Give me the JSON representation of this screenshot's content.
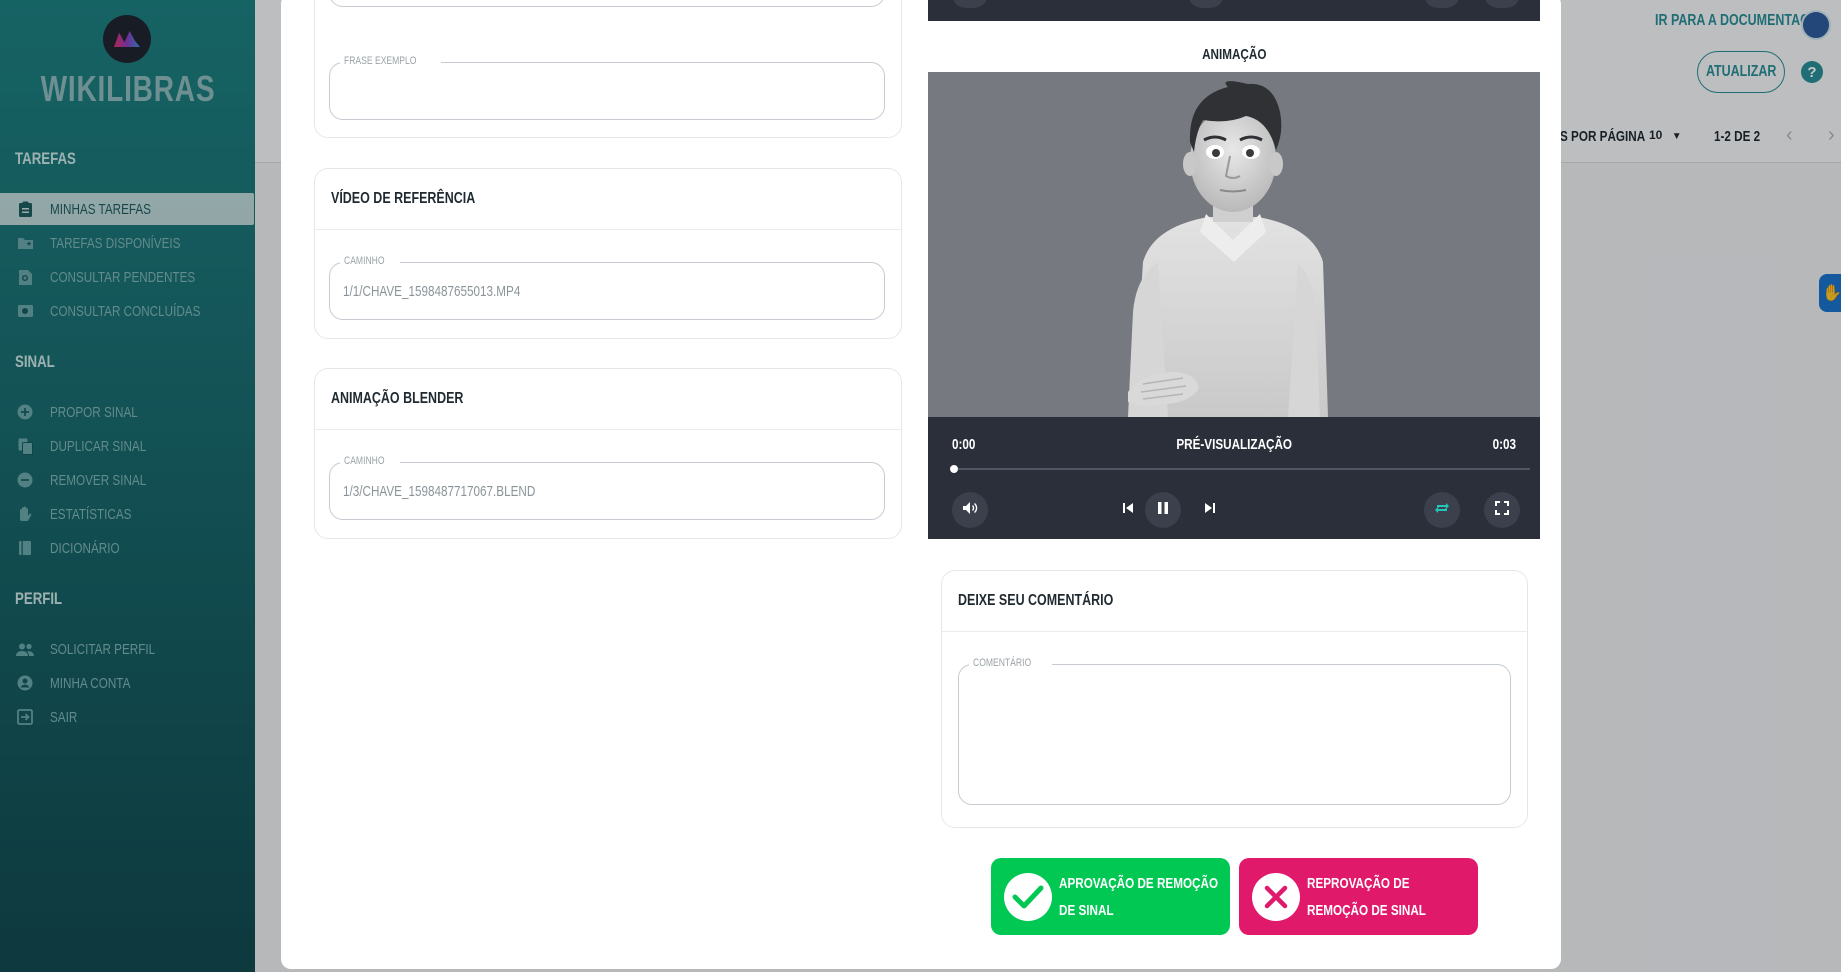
{
  "app": {
    "name": "WIKILIBRAS"
  },
  "sidebar": {
    "sections": [
      {
        "title": "TAREFAS"
      },
      {
        "title": "SINAL"
      },
      {
        "title": "PERFIL"
      }
    ],
    "items": [
      {
        "label": "MINHAS TAREFAS",
        "icon": "clipboard-icon",
        "active": true
      },
      {
        "label": "TAREFAS DISPONÍVEIS",
        "icon": "folder-add-icon"
      },
      {
        "label": "CONSULTAR PENDENTES",
        "icon": "search-doc-icon"
      },
      {
        "label": "CONSULTAR CONCLUÍDAS",
        "icon": "image-search-icon"
      },
      {
        "label": "PROPOR SINAL",
        "icon": "plus-circle-icon"
      },
      {
        "label": "DUPLICAR SINAL",
        "icon": "copy-icon"
      },
      {
        "label": "REMOVER SINAL",
        "icon": "minus-circle-icon"
      },
      {
        "label": "ESTATÍSTICAS",
        "icon": "hand-icon"
      },
      {
        "label": "DICIONÁRIO",
        "icon": "book-icon"
      },
      {
        "label": "SOLICITAR PERFIL",
        "icon": "people-icon"
      },
      {
        "label": "MINHA CONTA",
        "icon": "account-circle-icon"
      },
      {
        "label": "SAIR",
        "icon": "exit-icon"
      }
    ]
  },
  "header": {
    "doc_link": "IR PARA A DOCUMENTAÇÃO",
    "refresh_label": "ATUALIZAR",
    "help_label": "?",
    "per_page_label": "S POR PÁGINA",
    "per_page_value": "10",
    "page_range": "1-2 DE 2"
  },
  "form": {
    "example_phrase": {
      "legend": "FRASE EXEMPLO",
      "value": ""
    },
    "reference_video": {
      "title": "VÍDEO DE REFERÊNCIA",
      "legend": "CAMINHO",
      "value": "1/1/CHAVE_1598487655013.MP4"
    },
    "blender_animation": {
      "title": "ANIMAÇÃO BLENDER",
      "legend": "CAMINHO",
      "value": "1/3/CHAVE_1598487717067.BLEND"
    }
  },
  "player": {
    "section_title": "ANIMAÇÃO",
    "time_current": "0:00",
    "title": "PRÉ-VISUALIZAÇÃO",
    "time_total": "0:03",
    "progress": 0.0
  },
  "comment": {
    "title": "DEIXE SEU COMENTÁRIO",
    "legend": "COMENTÁRIO",
    "value": ""
  },
  "actions": {
    "approve_label": "APROVAÇÃO DE REMOÇÃO DE SINAL",
    "reject_label": "REPROVAÇÃO DE REMOÇÃO DE SINAL"
  },
  "colors": {
    "brand": "#1d7f80",
    "approve": "#00c853",
    "reject": "#e0196b",
    "player_bg": "#2b2f3a"
  }
}
